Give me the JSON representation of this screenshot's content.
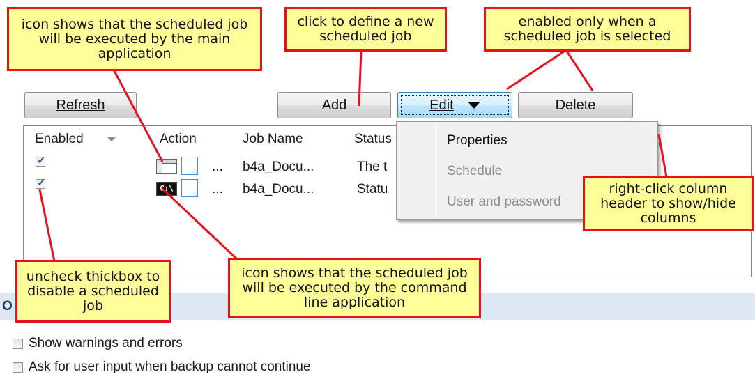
{
  "toolbar": {
    "refresh_label": "Refresh",
    "add_label": "Add",
    "edit_label": "Edit",
    "delete_label": "Delete"
  },
  "columns": [
    "Enabled",
    "Action",
    "Job Name",
    "Status"
  ],
  "rows": [
    {
      "enabled": true,
      "action_type": "main-application",
      "ellipsis": "...",
      "job_name": "b4a_Docu...",
      "status": "The t"
    },
    {
      "enabled": true,
      "action_type": "command-line",
      "ellipsis": "...",
      "job_name": "b4a_Docu...",
      "status": "Statu"
    }
  ],
  "context_menu": {
    "items": [
      {
        "label": "Properties",
        "enabled": true
      },
      {
        "label": "Schedule",
        "enabled": false
      },
      {
        "label": "User and password",
        "enabled": false
      }
    ]
  },
  "callouts": {
    "main_app_icon": "icon shows that the scheduled job will be executed by the main application",
    "add": "click to define a new scheduled job",
    "edit_enabled": "enabled only when a scheduled job is selected",
    "column_header": "right-click column header to show/hide columns",
    "checkbox": "uncheck thickbox to disable a scheduled job",
    "cmd_icon": "icon shows that the scheduled job will be executed by the command line application"
  },
  "options": {
    "section_title_partial": "O",
    "items": [
      {
        "label": "Show warnings and errors",
        "checked": false
      },
      {
        "label": "Ask for user input when backup cannot continue",
        "checked": false
      }
    ]
  },
  "colors": {
    "callout_fill": "#ffff99",
    "callout_border": "#e8101c",
    "section_bar": "#dde8f3"
  }
}
